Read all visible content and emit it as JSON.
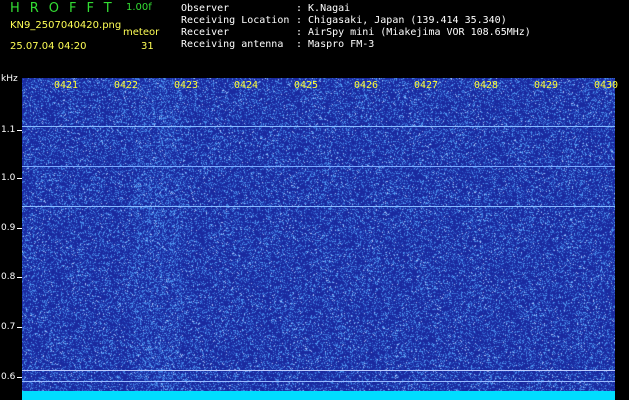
{
  "header": {
    "logo": "HROFFT",
    "version": "1.00f",
    "filename": "KN9_2507040420.png",
    "timestamp": "25.07.04 04:20",
    "meteor_label": "meteor",
    "meteor_count": "31"
  },
  "meta": [
    {
      "label": "Observer",
      "value": ": K.Nagai"
    },
    {
      "label": "Receiving Location",
      "value": ": Chigasaki, Japan (139.414 35.340)"
    },
    {
      "label": "Receiver",
      "value": ": AirSpy mini (Miakejima VOR 108.65MHz)"
    },
    {
      "label": "Receiving antenna",
      "value": ": Maspro FM-3"
    }
  ],
  "axis": {
    "unit": "kHz",
    "time_labels": [
      "0421",
      "0422",
      "0423",
      "0424",
      "0425",
      "0426",
      "0427",
      "0428",
      "0429",
      "0430"
    ],
    "freq_labels": [
      "1.1",
      "1.0",
      "0.9",
      "0.8",
      "0.7",
      "0.6"
    ]
  },
  "colors": {
    "background": "#000000",
    "plot": "#1a2aa0",
    "noise": "#5577ff",
    "baseline": "#00ddff",
    "logo": "#33dd33",
    "info": "#ffff55",
    "time_label": "#ffff33"
  }
}
